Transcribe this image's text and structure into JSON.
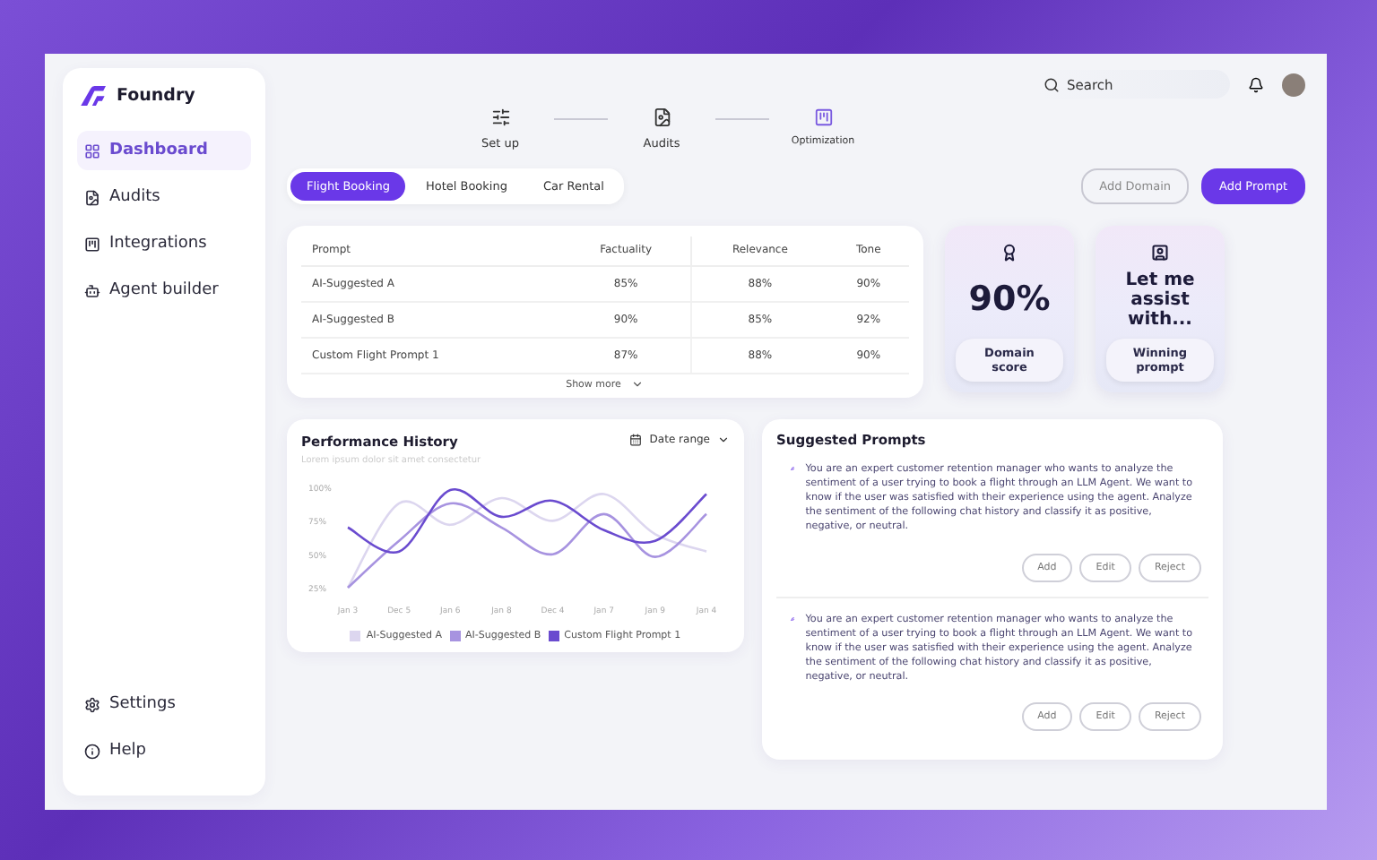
{
  "brand": {
    "name": "Foundry"
  },
  "nav": [
    {
      "label": "Dashboard",
      "selected": true
    },
    {
      "label": "Audits",
      "selected": false
    },
    {
      "label": "Integrations",
      "selected": false
    },
    {
      "label": "Agent builder",
      "selected": false
    }
  ],
  "nav_bottom": [
    {
      "label": "Settings",
      "selected": false
    },
    {
      "label": "Help",
      "selected": false
    }
  ],
  "search": {
    "placeholder": "Search"
  },
  "steps": [
    {
      "label": "Set up",
      "selected": false
    },
    {
      "label": "Audits",
      "selected": false
    },
    {
      "label": "Optimization",
      "selected": true
    }
  ],
  "tabs": [
    {
      "label": "Flight Booking",
      "selected": true
    },
    {
      "label": "Hotel Booking",
      "selected": false
    },
    {
      "label": "Car Rental",
      "selected": false
    }
  ],
  "actions": [
    {
      "label": "Add Domain",
      "kind": "outline"
    },
    {
      "label": "Add Prompt",
      "kind": "primary"
    }
  ],
  "table": {
    "columns": [
      "Prompt",
      "Factuality",
      "Relevance",
      "Tone"
    ],
    "rows": [
      [
        "AI-Suggested A",
        "85%",
        "88%",
        "90%"
      ],
      [
        "AI-Suggested B",
        "90%",
        "85%",
        "92%"
      ],
      [
        "Custom Flight Prompt 1",
        "87%",
        "88%",
        "90%"
      ]
    ],
    "show_more": "Show more"
  },
  "score_cards": [
    {
      "kind": "metric",
      "value": "90%",
      "label": "Domain score"
    },
    {
      "kind": "message",
      "value": "Let me assist with...",
      "label": "Winning prompt"
    }
  ],
  "performance": {
    "title": "Performance History",
    "subtitle": "Lorem ipsum dolor sit amet consectetur",
    "date_range": "Date range",
    "chart_data": {
      "type": "line",
      "categories": [
        "Jan 3",
        "Dec 5",
        "Jan 6",
        "Jan 8",
        "Dec 4",
        "Jan 7",
        "Jan 9",
        "Jan 4"
      ],
      "legend": true,
      "ylim": [
        25,
        100
      ],
      "yticks": [
        {
          "value": 25,
          "label": "25%"
        },
        {
          "value": 50,
          "label": "50%"
        },
        {
          "value": 75,
          "label": "75%"
        },
        {
          "value": 100,
          "label": "100%"
        }
      ],
      "series": [
        {
          "name": "AI-Suggested A",
          "color": "#dcd6ef",
          "values": [
            25,
            88,
            72,
            92,
            75,
            95,
            65,
            52
          ]
        },
        {
          "name": "AI-Suggested B",
          "color": "#a793e0",
          "values": [
            25,
            60,
            88,
            70,
            50,
            80,
            48,
            80
          ]
        },
        {
          "name": "Custom Flight Prompt 1",
          "color": "#6a4bcf",
          "values": [
            70,
            52,
            98,
            78,
            90,
            68,
            60,
            95
          ]
        }
      ]
    }
  },
  "suggested": {
    "title": "Suggested Prompts",
    "prompts": [
      {
        "text": "You are an expert customer retention manager who wants to analyze the sentiment of a user trying to book a flight through an LLM Agent. We want to know if the user was satisfied with their experience using the agent. Analyze the sentiment of the following chat history and classify it as positive, negative, or neutral.",
        "buttons": [
          "Add",
          "Edit",
          "Reject"
        ]
      },
      {
        "text": "You are an expert customer retention manager who wants to analyze the sentiment of a user trying to book a flight through an LLM Agent. We want to know if the user was satisfied with their experience using the agent. Analyze the sentiment of the following chat history and classify it as positive, negative, or neutral.",
        "buttons": [
          "Add",
          "Edit",
          "Reject"
        ]
      }
    ]
  }
}
